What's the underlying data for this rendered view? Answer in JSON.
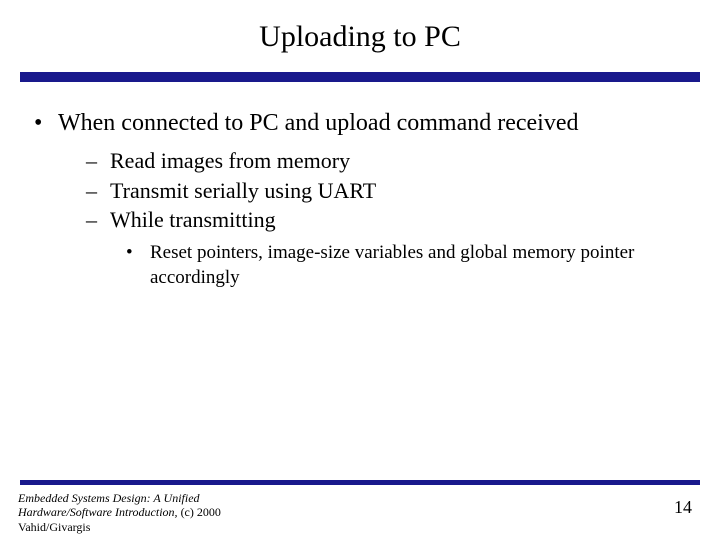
{
  "title": "Uploading to PC",
  "bullets": {
    "l1": "When connected to PC and upload command received",
    "l2a": "Read images from memory",
    "l2b": "Transmit serially using UART",
    "l2c": "While transmitting",
    "l3a": "Reset pointers, image-size variables and global memory pointer accordingly"
  },
  "footer": {
    "book": "Embedded Systems Design: A Unified Hardware/Software Introduction,",
    "copyright": " (c) 2000 Vahid/Givargis",
    "page": "14"
  },
  "colors": {
    "rule": "#19198c"
  }
}
